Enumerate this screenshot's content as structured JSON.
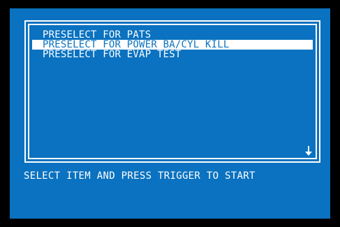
{
  "menu": {
    "items": [
      {
        "label": "PRESELECT FOR PATS",
        "selected": false
      },
      {
        "label": "PRESELECT FOR POWER BA/CYL KILL",
        "selected": true
      },
      {
        "label": "PRESELECT FOR EVAP TEST",
        "selected": false
      }
    ],
    "scroll_icon": "arrow-down-icon"
  },
  "footer": {
    "instruction": "SELECT ITEM AND PRESS TRIGGER TO START"
  },
  "colors": {
    "background": "#0a72c0",
    "foreground": "#ffffff",
    "bezel": "#000000"
  }
}
